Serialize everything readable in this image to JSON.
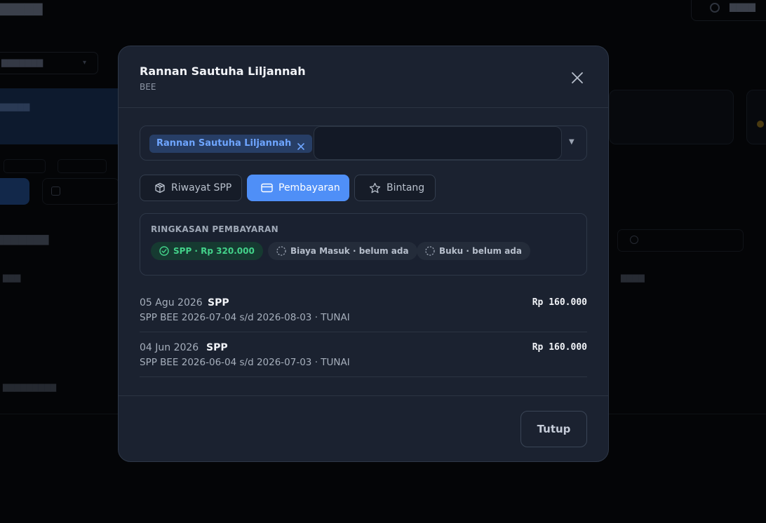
{
  "modal": {
    "title": "Rannan Sautuha Liljannah",
    "subtitle": "BEE",
    "selected_student": "Rannan Sautuha Liljannah",
    "search_value": "",
    "tabs": [
      {
        "label": "Riwayat SPP",
        "icon": "package-icon",
        "active": false
      },
      {
        "label": "Pembayaran",
        "icon": "credit-card-icon",
        "active": true
      },
      {
        "label": "Bintang",
        "icon": "star-icon",
        "active": false
      }
    ],
    "summary": {
      "heading": "RINGKASAN PEMBAYARAN",
      "items": [
        {
          "label": "SPP · Rp 320.000",
          "status": "paid",
          "icon": "check-circle-icon"
        },
        {
          "label": "Biaya Masuk · belum ada",
          "status": "none",
          "icon": "dashed-circle-icon"
        },
        {
          "label": "Buku · belum ada",
          "status": "none",
          "icon": "dashed-circle-icon"
        }
      ]
    },
    "payments": [
      {
        "date": "05 Agu 2026",
        "type": "SPP",
        "description": "SPP BEE 2026-07-04 s/d 2026-08-03 · TUNAI",
        "amount": "Rp 160.000"
      },
      {
        "date": "04 Jun 2026",
        "type": "SPP",
        "description": "SPP BEE 2026-06-04 s/d 2026-07-03 · TUNAI",
        "amount": "Rp 160.000"
      }
    ],
    "close_label": "Tutup"
  },
  "colors": {
    "accent": "#4f8ff7",
    "modal_bg": "#1b2230",
    "success": "#43d28a",
    "tag_text": "#6ea5ff"
  }
}
